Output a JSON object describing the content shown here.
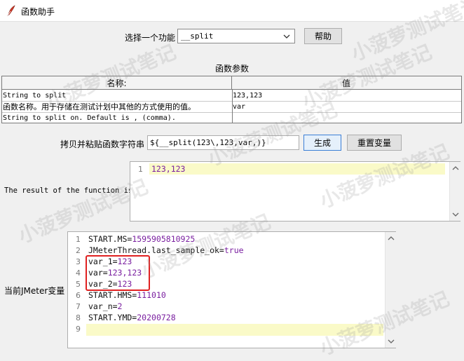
{
  "window": {
    "title": "函数助手"
  },
  "function_select": {
    "label": "选择一个功能",
    "selected": "__split",
    "help_label": "帮助"
  },
  "params": {
    "section_title": "函数参数",
    "headers": [
      "名称:",
      "值"
    ],
    "rows": [
      {
        "name": "String to split",
        "value": "123,123"
      },
      {
        "name": "函数名称。用于存储在测试计划中其他的方式使用的值。",
        "value": "var"
      },
      {
        "name": "String to split on. Default is , (comma).",
        "value": ""
      }
    ]
  },
  "function_string": {
    "label": "拷贝并粘贴函数字符串",
    "value": "${__split(123\\,123,var,)}",
    "generate_label": "生成",
    "reset_label": "重置变量"
  },
  "result": {
    "label": "The result of the function is",
    "lines": [
      {
        "num": "1",
        "text": "123,123"
      }
    ]
  },
  "jmeter_vars": {
    "label": "当前JMeter变量",
    "lines": [
      {
        "num": "1",
        "key": "START.MS=",
        "val": "1595905810925"
      },
      {
        "num": "2",
        "key": "JMeterThread.last_sample_ok=",
        "val": "true"
      },
      {
        "num": "3",
        "key": "var_1=",
        "val": "123"
      },
      {
        "num": "4",
        "key": "var=",
        "val": "123,123"
      },
      {
        "num": "5",
        "key": "var_2=",
        "val": "123"
      },
      {
        "num": "6",
        "key": "START.HMS=",
        "val": "111010"
      },
      {
        "num": "7",
        "key": "var_n=",
        "val": "2"
      },
      {
        "num": "8",
        "key": "START.YMD=",
        "val": "20200728"
      },
      {
        "num": "9",
        "key": "",
        "val": ""
      }
    ]
  },
  "watermark": "小菠萝测试笔记",
  "colors": {
    "highlight": "#fafac8",
    "value_text": "#7a1fa0",
    "annotation_box": "#e02020"
  }
}
